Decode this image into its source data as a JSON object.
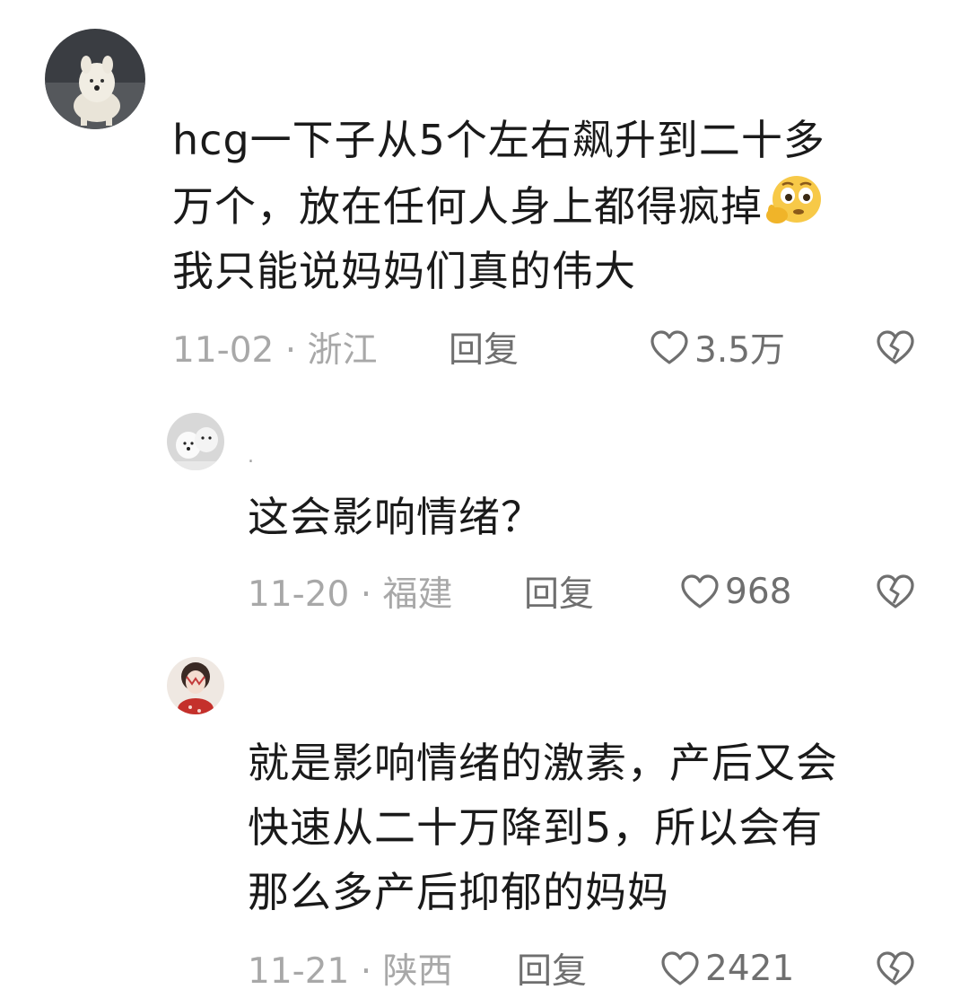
{
  "comments": [
    {
      "user": "",
      "lines": [
        "hcg一下子从5个左右飙升到二十多",
        "万个，放在任何人身上都得疯掉",
        "我只能说妈妈们真的伟大"
      ],
      "emoji": "thinking-face-emoji",
      "date": "11-02",
      "location": "浙江",
      "reply_label": "回复",
      "likes": "3.5万"
    },
    {
      "user": ".",
      "lines": [
        "这会影响情绪？"
      ],
      "date": "11-20",
      "location": "福建",
      "reply_label": "回复",
      "likes": "968"
    },
    {
      "user": "",
      "lines": [
        "就是影响情绪的激素，产后又会",
        "快速从二十万降到5，所以会有",
        "那么多产后抑郁的妈妈"
      ],
      "date": "11-21",
      "location": "陕西",
      "reply_label": "回复",
      "likes": "2421"
    }
  ],
  "separator": " · ",
  "icons": {
    "like": "heart-outline-icon",
    "dislike": "broken-heart-icon"
  },
  "colors": {
    "text": "#1a1a1a",
    "meta": "#a8a8a8",
    "action": "#6f6f6f"
  }
}
